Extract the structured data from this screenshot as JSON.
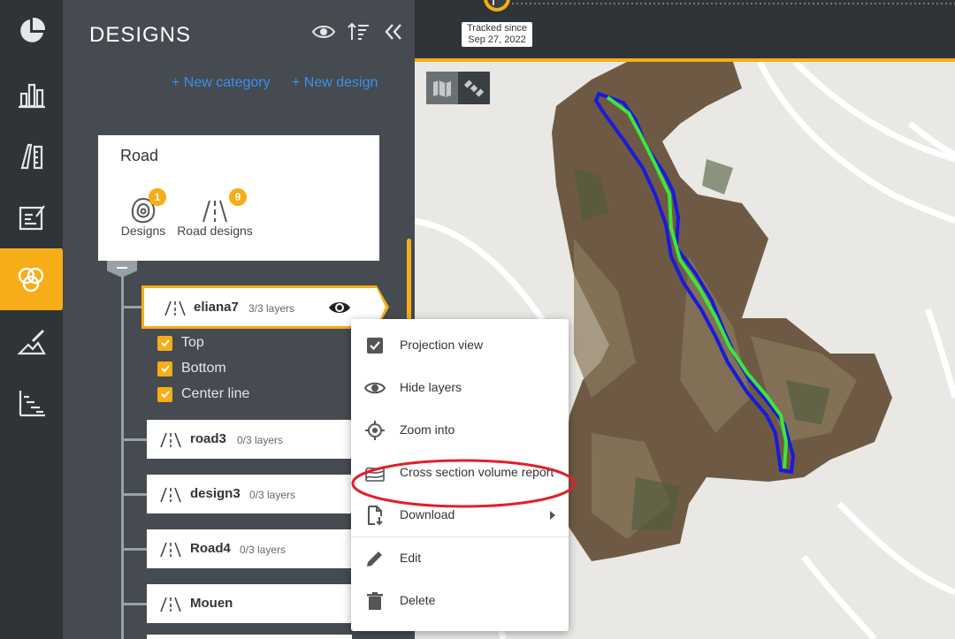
{
  "rail": {
    "items": [
      {
        "name": "dashboard-icon"
      },
      {
        "name": "stats-icon"
      },
      {
        "name": "measure-icon"
      },
      {
        "name": "report-icon"
      },
      {
        "name": "designs-icon",
        "active": true
      },
      {
        "name": "annotate-icon"
      },
      {
        "name": "timeline-icon"
      }
    ]
  },
  "panel": {
    "title": "DESIGNS",
    "new_category": "+ New category",
    "new_design": "+ New design",
    "category": {
      "title": "Road",
      "stats": [
        {
          "label": "Designs",
          "count": "1",
          "icon": "design-contour-icon"
        },
        {
          "label": "Road designs",
          "count": "9",
          "icon": "road-icon"
        }
      ]
    },
    "active_design": {
      "name": "eliana7",
      "layers": "3/3 layers"
    },
    "layers": [
      "Top",
      "Bottom",
      "Center line"
    ],
    "designs": [
      {
        "name": "road3",
        "layers": "0/3 layers"
      },
      {
        "name": "design3",
        "layers": "0/3 layers"
      },
      {
        "name": "Road4",
        "layers": "0/3 layers"
      },
      {
        "name": "Mouen",
        "layers": ""
      }
    ]
  },
  "map": {
    "tracked_line1": "Tracked since",
    "tracked_line2": "Sep 27, 2022"
  },
  "menu": {
    "items": [
      {
        "label": "Projection view",
        "icon": "checkbox-icon"
      },
      {
        "label": "Hide layers",
        "icon": "eye-icon"
      },
      {
        "label": "Zoom into",
        "icon": "target-icon"
      },
      {
        "label": "Cross section volume report",
        "icon": "cross-section-icon"
      },
      {
        "label": "Download",
        "icon": "download-icon"
      },
      {
        "label": "Edit",
        "icon": "pencil-icon"
      },
      {
        "label": "Delete",
        "icon": "trash-icon"
      }
    ]
  },
  "colors": {
    "accent": "#f6ad17",
    "rail_bg": "#2f3438",
    "panel_bg": "#454b50",
    "link": "#3d8fee",
    "annotation": "#e0202a",
    "line_blue": "#1a1adb",
    "line_green": "#3ee63a"
  }
}
